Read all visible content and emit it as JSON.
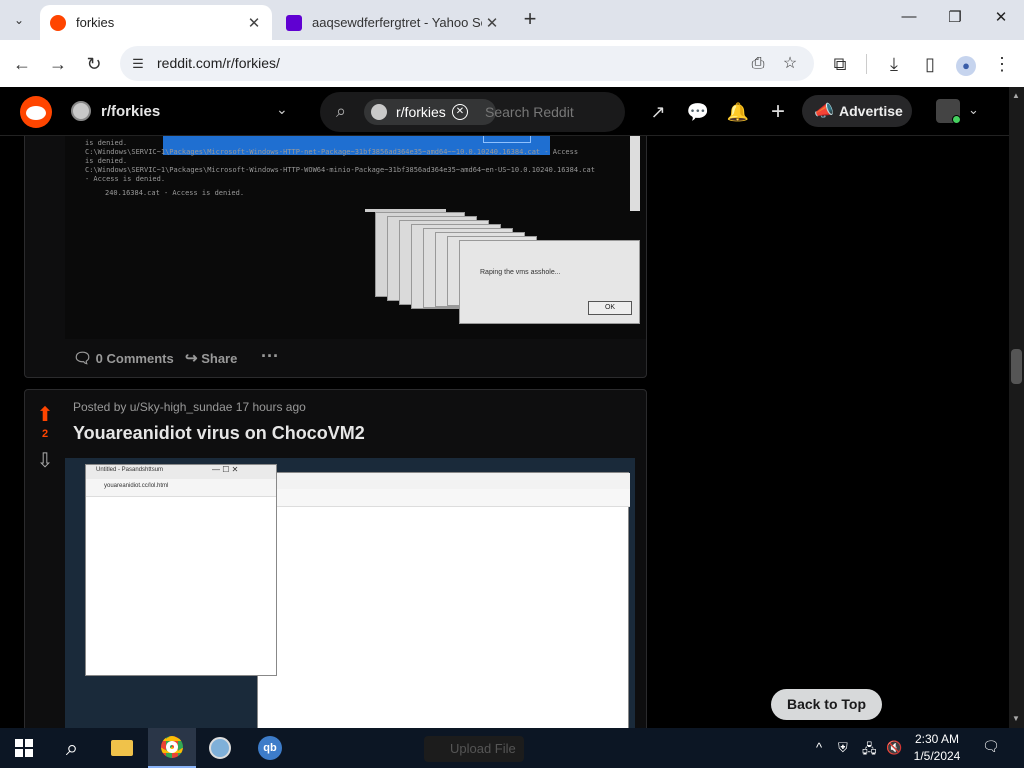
{
  "browser": {
    "tabs": [
      {
        "title": "forkies",
        "active": true
      },
      {
        "title": "aaqsewdferfergtret - Yahoo Se",
        "active": false
      }
    ],
    "url": "reddit.com/r/forkies/"
  },
  "reddit_header": {
    "subreddit": "r/forkies",
    "search_chip": "r/forkies",
    "search_placeholder": "Search Reddit",
    "advertise_label": "Advertise"
  },
  "post1": {
    "media_dialog_text": "Raping the vms asshole...",
    "media_dialog_ok": "OK",
    "comments_label": "0 Comments",
    "share_label": "Share"
  },
  "post2": {
    "votes": "2",
    "meta": "Posted by u/Sky-high_sundae 17 hours ago",
    "title": "Youareanidiot virus on ChocoVM2",
    "media_window_title": "Untitled - Pasandshttsum",
    "media_window_url": "youareanidiot.cc/lol.html"
  },
  "back_to_top_label": "Back to Top",
  "taskbar": {
    "time": "2:30 AM",
    "date": "1/5/2024",
    "ghost_label": "Upload File"
  },
  "colors": {
    "reddit_orange": "#ff4500",
    "chrome_tabstrip": "#dfe3eb",
    "taskbar": "#0c1624"
  }
}
